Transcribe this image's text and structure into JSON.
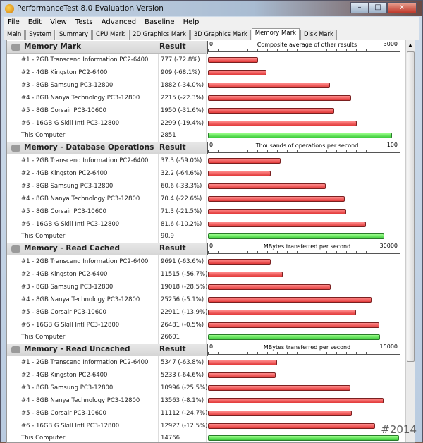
{
  "window": {
    "title": "PerformanceTest 8.0 Evaluation Version",
    "controls": [
      "–",
      "□",
      "x"
    ]
  },
  "menu": [
    "File",
    "Edit",
    "View",
    "Tests",
    "Advanced",
    "Baseline",
    "Help"
  ],
  "tabs": [
    {
      "label": "Main"
    },
    {
      "label": "System"
    },
    {
      "label": "Summary"
    },
    {
      "label": "CPU Mark"
    },
    {
      "label": "2D Graphics Mark"
    },
    {
      "label": "3D Graphics Mark"
    },
    {
      "label": "Memory Mark",
      "active": true
    },
    {
      "label": "Disk Mark"
    }
  ],
  "colors": {
    "bar_other": "#e23a3a",
    "bar_this": "#3ccc3a"
  },
  "sections": [
    {
      "title": "Memory Mark",
      "result_header": "Result",
      "axis_min": "0",
      "axis_label": "Composite average of other results",
      "axis_max": 3000,
      "rows": [
        {
          "name": "#1 - 2GB Transcend Information PC2-6400",
          "result": "777 (-72.8%)",
          "value": 777
        },
        {
          "name": "#2 - 4GB Kingston PC2-6400",
          "result": "909 (-68.1%)",
          "value": 909
        },
        {
          "name": "#3 - 8GB Samsung PC3-12800",
          "result": "1882 (-34.0%)",
          "value": 1882
        },
        {
          "name": "#4 - 8GB Nanya Technology PC3-12800",
          "result": "2215 (-22.3%)",
          "value": 2215
        },
        {
          "name": "#5 - 8GB Corsair PC3-10600",
          "result": "1950 (-31.6%)",
          "value": 1950
        },
        {
          "name": "#6 - 16GB G Skill Intl PC3-12800",
          "result": "2299 (-19.4%)",
          "value": 2299
        },
        {
          "name": "This Computer",
          "result": "2851",
          "value": 2851,
          "this": true
        }
      ]
    },
    {
      "title": "Memory - Database Operations",
      "result_header": "Result",
      "axis_min": "0",
      "axis_label": "Thousands of operations per second",
      "axis_max": 100,
      "rows": [
        {
          "name": "#1 - 2GB Transcend Information PC2-6400",
          "result": "37.3 (-59.0%)",
          "value": 37.3
        },
        {
          "name": "#2 - 4GB Kingston PC2-6400",
          "result": "32.2 (-64.6%)",
          "value": 32.2
        },
        {
          "name": "#3 - 8GB Samsung PC3-12800",
          "result": "60.6 (-33.3%)",
          "value": 60.6
        },
        {
          "name": "#4 - 8GB Nanya Technology PC3-12800",
          "result": "70.4 (-22.6%)",
          "value": 70.4
        },
        {
          "name": "#5 - 8GB Corsair PC3-10600",
          "result": "71.3 (-21.5%)",
          "value": 71.3
        },
        {
          "name": "#6 - 16GB G Skill Intl PC3-12800",
          "result": "81.6 (-10.2%)",
          "value": 81.6
        },
        {
          "name": "This Computer",
          "result": "90.9",
          "value": 90.9,
          "this": true
        }
      ]
    },
    {
      "title": "Memory - Read Cached",
      "result_header": "Result",
      "axis_min": "0",
      "axis_label": "MBytes transferred per second",
      "axis_max": 30000,
      "rows": [
        {
          "name": "#1 - 2GB Transcend Information PC2-6400",
          "result": "9691 (-63.6%)",
          "value": 9691
        },
        {
          "name": "#2 - 4GB Kingston PC2-6400",
          "result": "11515 (-56.7%)",
          "value": 11515
        },
        {
          "name": "#3 - 8GB Samsung PC3-12800",
          "result": "19018 (-28.5%)",
          "value": 19018
        },
        {
          "name": "#4 - 8GB Nanya Technology PC3-12800",
          "result": "25256 (-5.1%)",
          "value": 25256
        },
        {
          "name": "#5 - 8GB Corsair PC3-10600",
          "result": "22911 (-13.9%)",
          "value": 22911
        },
        {
          "name": "#6 - 16GB G Skill Intl PC3-12800",
          "result": "26481 (-0.5%)",
          "value": 26481
        },
        {
          "name": "This Computer",
          "result": "26601",
          "value": 26601,
          "this": true
        }
      ]
    },
    {
      "title": "Memory - Read Uncached",
      "result_header": "Result",
      "axis_min": "0",
      "axis_label": "MBytes transferred per second",
      "axis_max": 15000,
      "rows": [
        {
          "name": "#1 - 2GB Transcend Information PC2-6400",
          "result": "5347 (-63.8%)",
          "value": 5347
        },
        {
          "name": "#2 - 4GB Kingston PC2-6400",
          "result": "5233 (-64.6%)",
          "value": 5233
        },
        {
          "name": "#3 - 8GB Samsung PC3-12800",
          "result": "10996 (-25.5%)",
          "value": 10996
        },
        {
          "name": "#4 - 8GB Nanya Technology PC3-12800",
          "result": "13563 (-8.1%)",
          "value": 13563
        },
        {
          "name": "#5 - 8GB Corsair PC3-10600",
          "result": "11112 (-24.7%)",
          "value": 11112
        },
        {
          "name": "#6 - 16GB G Skill Intl PC3-12800",
          "result": "12927 (-12.5%)",
          "value": 12927
        },
        {
          "name": "This Computer",
          "result": "14766",
          "value": 14766,
          "this": true
        }
      ]
    }
  ],
  "watermark": "#2014"
}
